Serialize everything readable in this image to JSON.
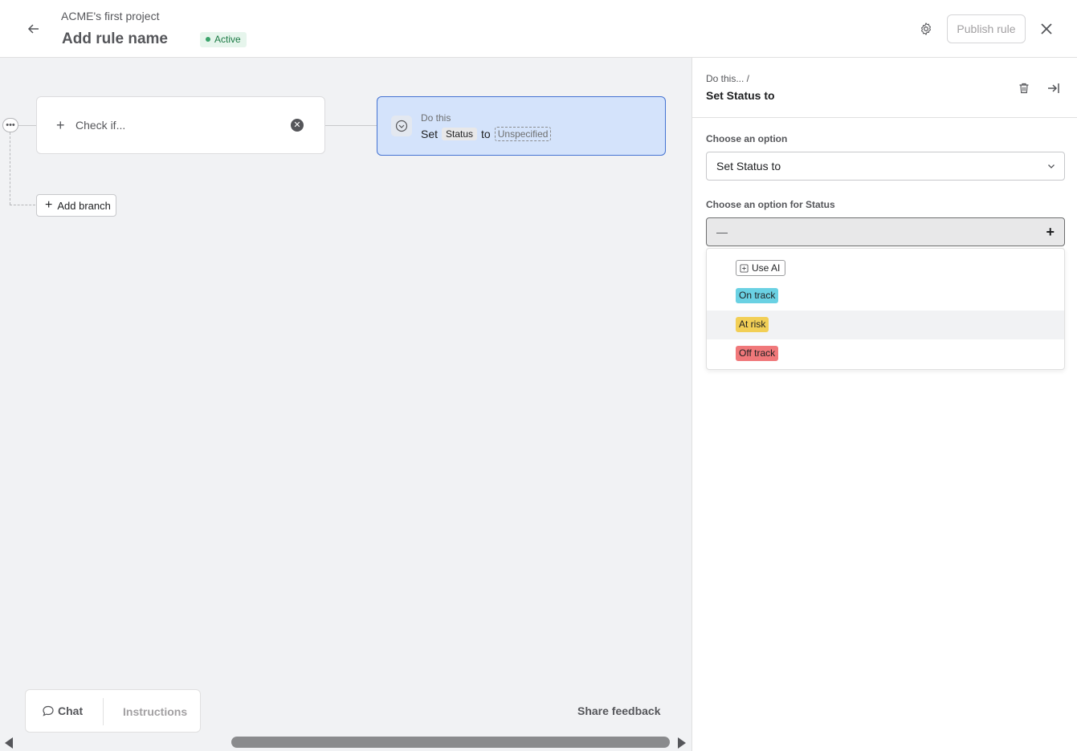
{
  "header": {
    "project_name": "ACME's first project",
    "rule_name": "Add rule name",
    "status": "Active",
    "publish_label": "Publish rule"
  },
  "canvas": {
    "check_label": "Check if...",
    "do_title": "Do this",
    "do_set": "Set",
    "do_field": "Status",
    "do_to": "to",
    "do_value": "Unspecified",
    "add_branch": "Add branch",
    "chat_tab": "Chat",
    "instructions_tab": "Instructions",
    "share_feedback": "Share feedback"
  },
  "panel": {
    "breadcrumb": "Do this...  /",
    "title": "Set Status to",
    "choose_option_label": "Choose an option",
    "choose_option_value": "Set Status to",
    "status_option_label": "Choose an option for Status",
    "status_option_value": "—",
    "options": [
      {
        "label": "Use AI",
        "kind": "ai"
      },
      {
        "label": "On track",
        "color": "#6ad1e3"
      },
      {
        "label": "At risk",
        "color": "#f2cf56"
      },
      {
        "label": "Off track",
        "color": "#f0787a"
      }
    ],
    "highlighted_option": "At risk"
  }
}
